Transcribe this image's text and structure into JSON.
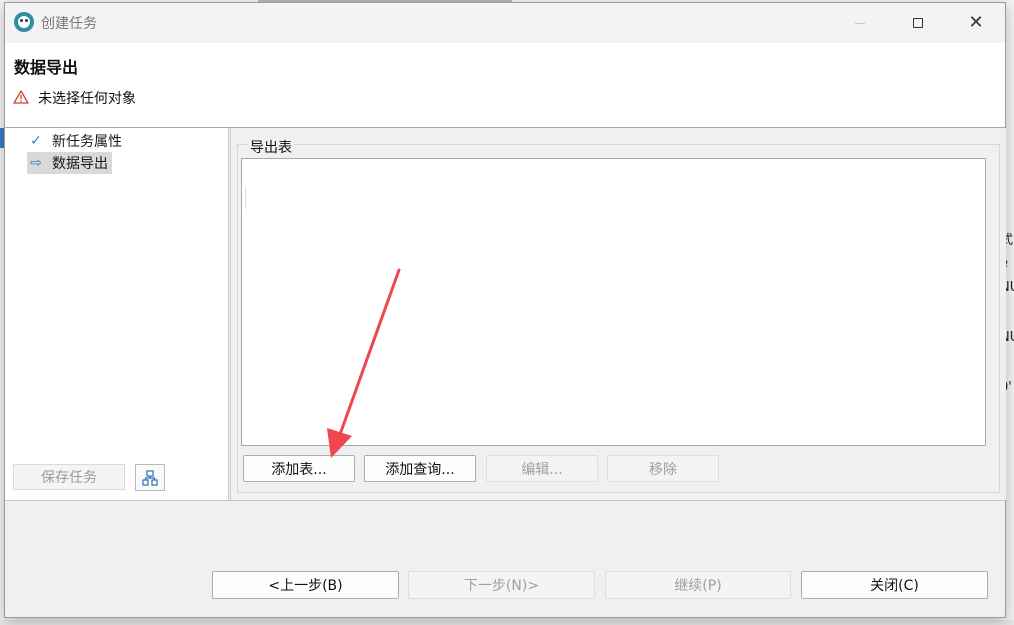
{
  "dialog": {
    "title": "创建任务",
    "header_title": "数据导出",
    "header_message": "未选择任何对象"
  },
  "nav": {
    "items": [
      {
        "label": "新任务属性",
        "icon": "check-icon"
      },
      {
        "label": "数据导出",
        "icon": "arrow-right-icon"
      }
    ],
    "save_task_label": "保存任务"
  },
  "content": {
    "group_label": "导出表",
    "buttons": {
      "add_table": "添加表...",
      "add_query": "添加查询...",
      "edit": "编辑...",
      "remove": "移除"
    }
  },
  "footer": {
    "prev": "<上一步(B)",
    "next": "下一步(N)>",
    "continue": "继续(P)",
    "close": "关闭(C)"
  },
  "background": {
    "right_fragments": [
      "式",
      "e",
      "NU",
      "NU",
      "0'"
    ]
  },
  "colors": {
    "accent": "#3a7bbf",
    "warning": "#c8442e",
    "annotation_arrow": "#ef4650"
  }
}
